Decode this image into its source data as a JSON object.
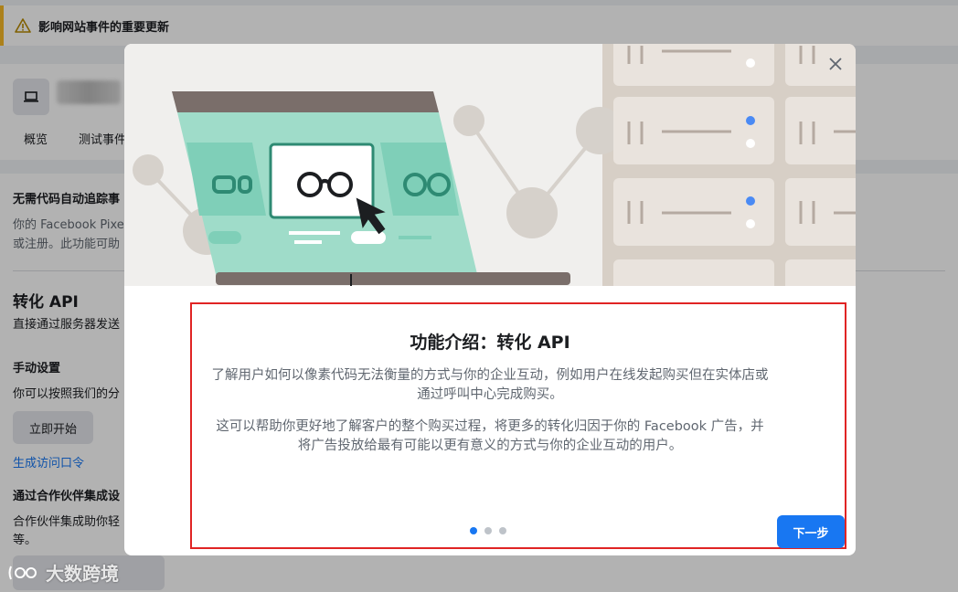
{
  "banner": {
    "text": "影响网站事件的重要更新"
  },
  "page": {
    "tabs": [
      "概览",
      "测试事件"
    ],
    "auto_tracking_title": "无需代码自动追踪事",
    "auto_tracking_desc_1": "你的 Facebook Pixe",
    "auto_tracking_desc_2": "或注册。此功能可助",
    "conversions_api_heading": "转化 API",
    "conversions_api_desc": "直接通过服务器发送",
    "manual_setup_title": "手动设置",
    "manual_setup_desc": "你可以按照我们的分",
    "start_button": "立即开始",
    "generate_token_link": "生成访问口令",
    "partner_title": "通过合作伙伴集成设",
    "partner_desc_1": "合作伙伴集成助你轻",
    "partner_desc_2": "等。"
  },
  "watermark": {
    "text": "大数跨境"
  },
  "modal": {
    "title": "功能介绍：转化 API",
    "paragraph_1": "了解用户如何以像素代码无法衡量的方式与你的企业互动，例如用户在线发起购买但在实体店或通过呼叫中心完成购买。",
    "paragraph_2": "这可以帮助你更好地了解客户的整个购买过程，将更多的转化归因于你的 Facebook 广告，并将广告投放给最有可能以更有意义的方式与你的企业互动的用户。",
    "next_button": "下一步",
    "pagination": {
      "current": 1,
      "total": 3
    }
  },
  "colors": {
    "accent": "#1877f2",
    "highlight_border": "#e02424",
    "warning": "#f7b928",
    "illustration_teal": "#9fdcc9",
    "illustration_server_bg": "#d7cfc6"
  },
  "icons": {
    "banner": "warning-icon",
    "device": "laptop-icon",
    "close": "close-icon"
  }
}
